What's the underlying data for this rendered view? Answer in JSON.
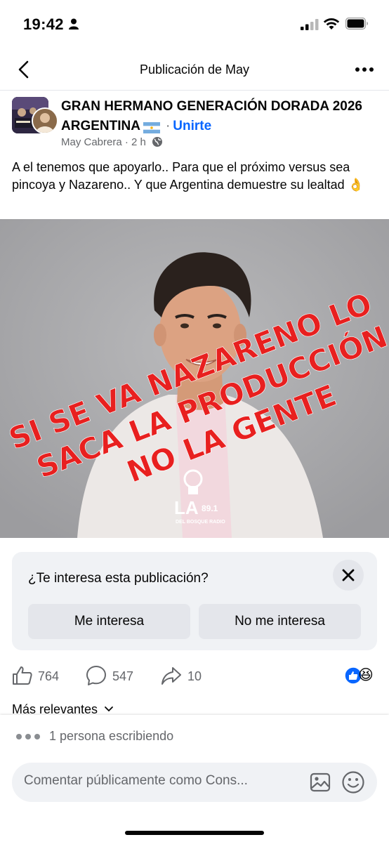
{
  "status_bar": {
    "time": "19:42"
  },
  "nav": {
    "title": "Publicación de May"
  },
  "post": {
    "group_name": "GRAN HERMANO GENERACIÓN DORADA 2026 ARGENTINA",
    "separator": "·",
    "join_label": "Unirte",
    "author": "May Cabrera",
    "time_ago": "2 h",
    "text": "A el tenemos que apoyarlo.. Para que el próximo versus sea pincoya y Nazareno.. Y que Argentina demuestre su lealtad",
    "text_emoji": "👌",
    "image": {
      "overlay_line1": "SI SE VA NAZARENO LO",
      "overlay_line2": "SACA LA PRODUCCIÓN",
      "overlay_line3": "NO LA GENTE",
      "logo_main": "LA",
      "logo_freq": "89.1",
      "logo_sub": "DEL BOSQUE RADIO",
      "overlay_color": "#e8201f"
    }
  },
  "interest": {
    "question": "¿Te interesa esta publicación?",
    "yes_label": "Me interesa",
    "no_label": "No me interesa"
  },
  "actions": {
    "likes": "764",
    "comments": "547",
    "shares": "10",
    "reaction_emoji_2": "😆"
  },
  "comments_section": {
    "sort_label": "Más relevantes"
  },
  "composer": {
    "typing": "1 persona escribiendo",
    "placeholder": "Comentar públicamente como Cons..."
  },
  "colors": {
    "accent": "#0866ff",
    "secondary_text": "#65676b",
    "card_bg": "#f0f2f5"
  }
}
